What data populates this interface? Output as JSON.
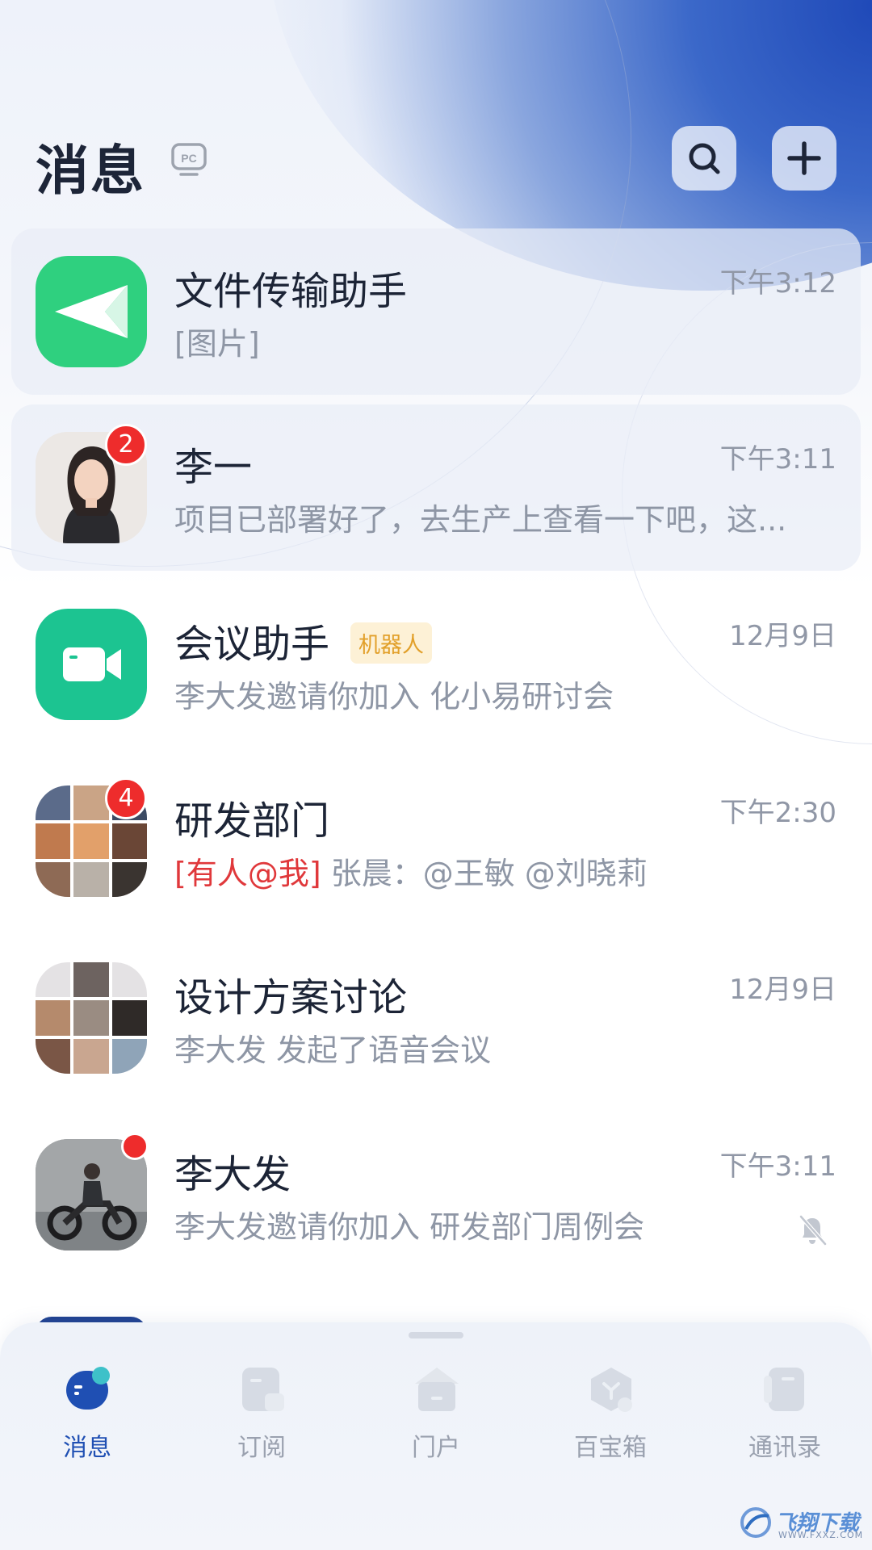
{
  "header": {
    "title": "消息",
    "pc_icon": "pc-monitor-icon",
    "search_icon": "search-icon",
    "add_icon": "plus-icon"
  },
  "conversations": [
    {
      "name": "文件传输助手",
      "message": "[图片]",
      "time": "下午3:12",
      "avatar": "paper-plane-icon",
      "pinned": true
    },
    {
      "name": "李一",
      "message": "项目已部署好了，去生产上查看一下吧，这...",
      "time": "下午3:11",
      "badge": "2",
      "avatar": "user-photo",
      "pinned": true
    },
    {
      "name": "会议助手",
      "tag": "机器人",
      "message": "李大发邀请你加入 化小易研讨会",
      "time": "12月9日",
      "avatar": "video-camera-icon"
    },
    {
      "name": "研发部门",
      "mention": "[有人@我]",
      "message": "张晨：@王敏 @刘晓莉",
      "time": "下午2:30",
      "badge": "4",
      "avatar": "group-photo-grid"
    },
    {
      "name": "设计方案讨论",
      "message": "李大发 发起了语音会议",
      "time": "12月9日",
      "avatar": "group-photo-grid"
    },
    {
      "name": "李大发",
      "message": "李大发邀请你加入 研发部门周例会",
      "time": "下午3:11",
      "dot": true,
      "muted": true,
      "avatar": "user-photo"
    }
  ],
  "tabs": [
    {
      "label": "消息",
      "icon": "message-icon",
      "active": true
    },
    {
      "label": "订阅",
      "icon": "subscribe-icon"
    },
    {
      "label": "门户",
      "icon": "portal-icon"
    },
    {
      "label": "百宝箱",
      "icon": "toolbox-icon"
    },
    {
      "label": "通讯录",
      "icon": "contacts-icon"
    }
  ],
  "watermark": {
    "text": "飞翔下载",
    "sub": "WWW.FXXZ.COM"
  },
  "colors": {
    "accent": "#1f4fb3",
    "badge": "#ee2c2c",
    "file_assistant": "#2fd07f",
    "meeting_assistant": "#1cc491",
    "mention": "#e0383b",
    "tag_bg": "#fdf1d6",
    "tag_text": "#e2a02a"
  }
}
